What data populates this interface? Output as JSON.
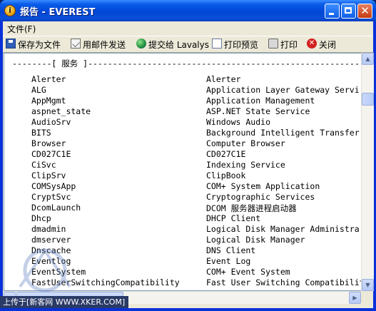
{
  "window": {
    "title": "报告 - EVEREST",
    "app_icon_glyph": "i"
  },
  "menu": {
    "file_label": "文件(F)"
  },
  "toolbar": {
    "save_label": "保存为文件",
    "mail_label": "用邮件发送",
    "submit_label": "提交给 Lavalys",
    "preview_label": "打印预览",
    "print_label": "打印",
    "close_label": "关闭"
  },
  "report": {
    "section_header": "--------[ 服务 ]---------------------------------------------------------",
    "rows": [
      {
        "name": "Alerter",
        "desc": "Alerter"
      },
      {
        "name": "ALG",
        "desc": "Application Layer Gateway Servi"
      },
      {
        "name": "AppMgmt",
        "desc": "Application Management"
      },
      {
        "name": "aspnet_state",
        "desc": "ASP.NET State Service"
      },
      {
        "name": "AudioSrv",
        "desc": "Windows Audio"
      },
      {
        "name": "BITS",
        "desc": "Background Intelligent Transfer"
      },
      {
        "name": "Browser",
        "desc": "Computer Browser"
      },
      {
        "name": "CD027C1E",
        "desc": "CD027C1E"
      },
      {
        "name": "CiSvc",
        "desc": "Indexing Service"
      },
      {
        "name": "ClipSrv",
        "desc": "ClipBook"
      },
      {
        "name": "COMSysApp",
        "desc": "COM+ System Application"
      },
      {
        "name": "CryptSvc",
        "desc": "Cryptographic Services"
      },
      {
        "name": "DcomLaunch",
        "desc": "DCOM 服务器进程启动器"
      },
      {
        "name": "Dhcp",
        "desc": "DHCP Client"
      },
      {
        "name": "dmadmin",
        "desc": "Logical Disk Manager Administra"
      },
      {
        "name": "dmserver",
        "desc": "Logical Disk Manager"
      },
      {
        "name": "Dnscache",
        "desc": "DNS Client"
      },
      {
        "name": "Eventlog",
        "desc": "Event Log"
      },
      {
        "name": "EventSystem",
        "desc": "COM+ Event System"
      },
      {
        "name": "FastUserSwitchingCompatibility",
        "desc": "Fast User Switching Compatibility"
      }
    ]
  },
  "status_bar": {
    "text": "上传于[新客网 WWW.XKER.COM]"
  },
  "colors": {
    "titlebar": "#0a4fd8",
    "face": "#ece9d8",
    "content_bg": "#ffffff",
    "status_bg": "#2a3a66"
  }
}
